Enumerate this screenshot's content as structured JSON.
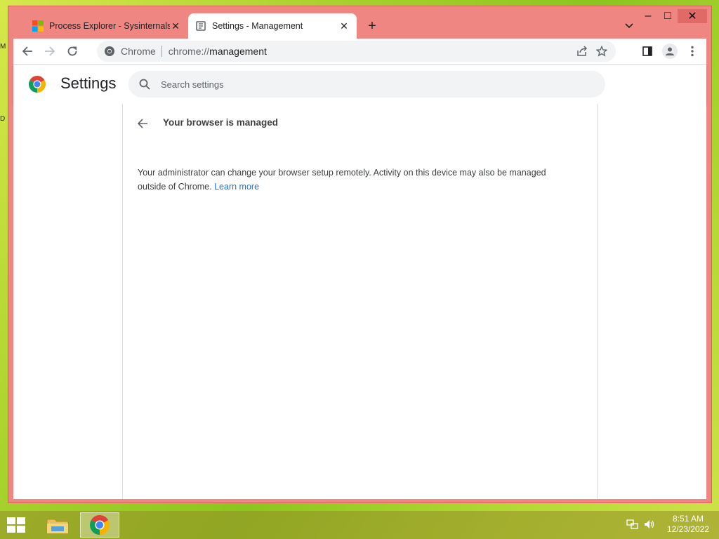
{
  "desktop": {
    "edge_icon_1": "M",
    "edge_icon_2": "D"
  },
  "window": {
    "controls": {
      "minimize": "–",
      "maximize": "□",
      "close": "✕"
    }
  },
  "tabs": [
    {
      "title": "Process Explorer - Sysinternals | Microsoft Learn",
      "favicon": "microsoft-logo"
    },
    {
      "title": "Settings - Management",
      "favicon": "settings-page-icon"
    }
  ],
  "toolbar": {
    "omnibox_chip": "Chrome",
    "url_scheme": "chrome://",
    "url_path": "management"
  },
  "settings": {
    "title": "Settings",
    "search_placeholder": "Search settings",
    "page_heading": "Your browser is managed",
    "message": "Your administrator can change your browser setup remotely. Activity on this device may also be managed outside of Chrome.",
    "learn_more": "Learn more"
  },
  "taskbar": {
    "time": "8:51 AM",
    "date": "12/23/2022"
  },
  "colors": {
    "window_frame": "#f08682",
    "link": "#1a73e8",
    "taskbar": "#968c28"
  }
}
